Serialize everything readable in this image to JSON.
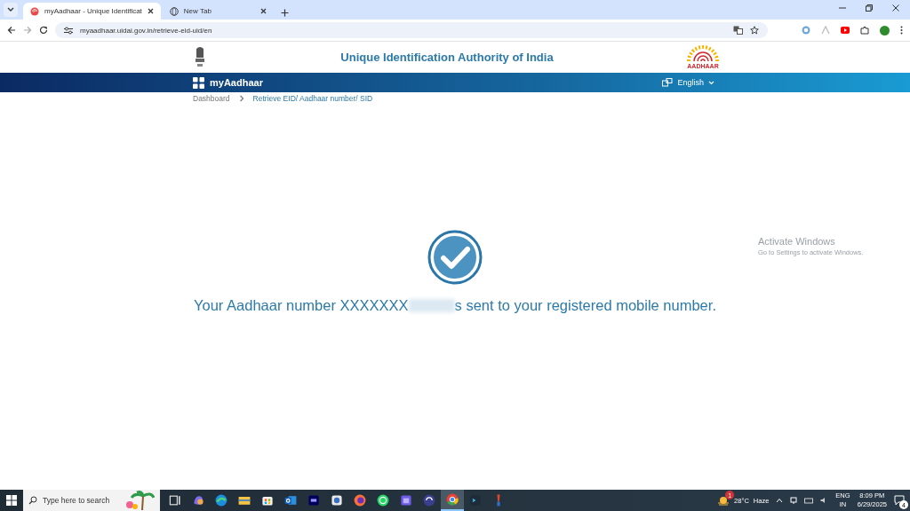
{
  "browser": {
    "tabs": [
      {
        "title": "myAadhaar - Unique Identificat",
        "kind": "aadhaar",
        "selected": true
      },
      {
        "title": "New Tab",
        "kind": "globe",
        "selected": false
      }
    ],
    "url": "myaadhaar.uidai.gov.in/retrieve-eid-uid/en"
  },
  "header": {
    "title": "Unique Identification Authority of India",
    "logo_caption": "AADHAAR"
  },
  "nav": {
    "brand": "myAadhaar",
    "language": "English"
  },
  "breadcrumb": [
    {
      "label": "Dashboard",
      "selected": false
    },
    {
      "label": "Retrieve EID/ Aadhaar number/ SID",
      "selected": true
    }
  ],
  "message": {
    "before": "Your Aadhaar number XXXXXXX",
    "after": "s sent to your registered mobile number."
  },
  "activation": {
    "title": "Activate Windows",
    "subtitle": "Go to Settings to activate Windows."
  },
  "taskbar": {
    "search_placeholder": "Type here to search",
    "apps": [
      {
        "kind": "taskview",
        "selected": false
      },
      {
        "kind": "copilot",
        "selected": false
      },
      {
        "kind": "edge",
        "selected": false
      },
      {
        "kind": "folder",
        "selected": false
      },
      {
        "kind": "store",
        "selected": false
      },
      {
        "kind": "outlook",
        "selected": false
      },
      {
        "kind": "audition",
        "selected": false
      },
      {
        "kind": "app",
        "selected": false
      },
      {
        "kind": "firefox",
        "selected": false
      },
      {
        "kind": "whatsapp",
        "selected": false
      },
      {
        "kind": "calendar",
        "selected": false
      },
      {
        "kind": "sync",
        "selected": false
      },
      {
        "kind": "chrome",
        "selected": true
      },
      {
        "kind": "terminal",
        "selected": false
      },
      {
        "kind": "paint",
        "selected": false
      }
    ],
    "weather_badge": "1",
    "temperature": "28°C",
    "condition": "Haze",
    "input_lang": "ENG",
    "input_region": "IN",
    "time": "8:09 PM",
    "date": "6/29/2025",
    "notifications": "4"
  }
}
